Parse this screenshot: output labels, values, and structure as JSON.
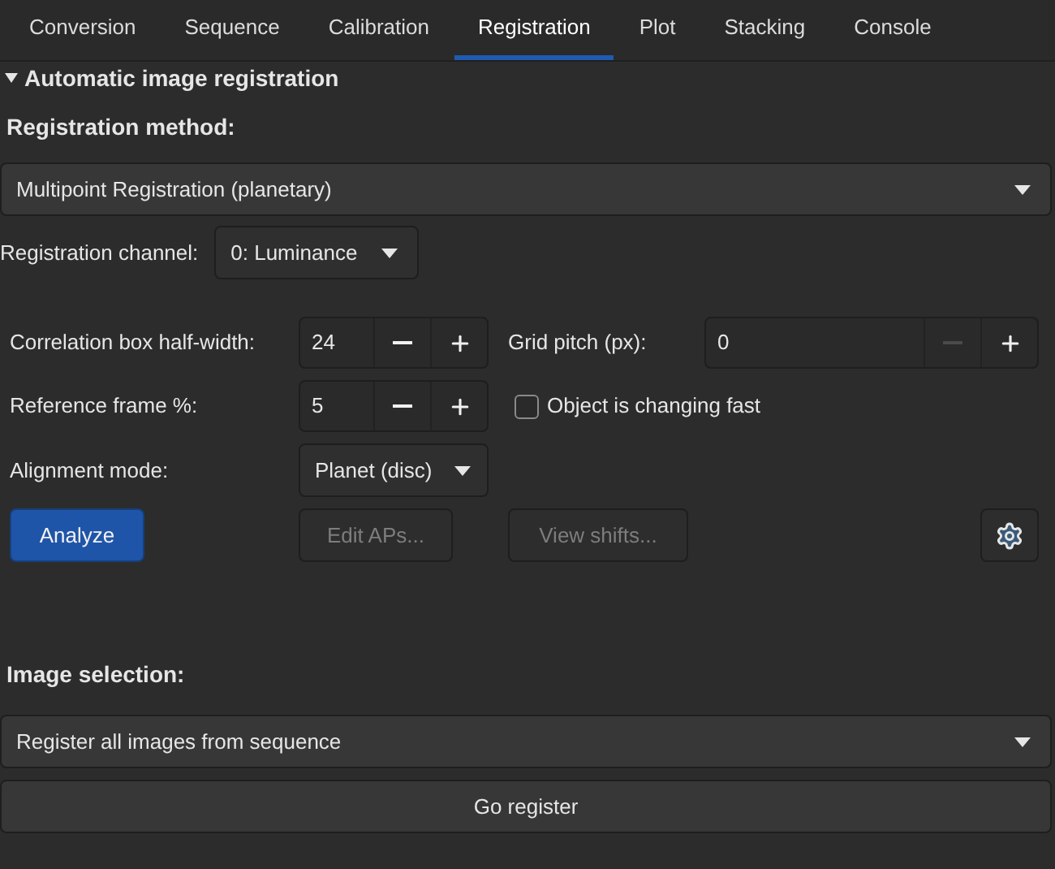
{
  "tabs": [
    {
      "label": "Conversion",
      "selected": false
    },
    {
      "label": "Sequence",
      "selected": false
    },
    {
      "label": "Calibration",
      "selected": false
    },
    {
      "label": "Registration",
      "selected": true
    },
    {
      "label": "Plot",
      "selected": false
    },
    {
      "label": "Stacking",
      "selected": false
    },
    {
      "label": "Console",
      "selected": false
    }
  ],
  "section": {
    "title": "Automatic image registration",
    "expanded": true
  },
  "method": {
    "label": "Registration method:",
    "value": "Multipoint Registration (planetary)"
  },
  "channel": {
    "label": "Registration channel:",
    "value": "0: Luminance"
  },
  "correlation": {
    "label": "Correlation box half-width:",
    "value": "24",
    "minus_disabled": false,
    "plus_disabled": false
  },
  "grid_pitch": {
    "label": "Grid pitch (px):",
    "value": "0",
    "minus_disabled": true,
    "plus_disabled": false
  },
  "reference_frame": {
    "label": "Reference frame %:",
    "value": "5",
    "minus_disabled": false,
    "plus_disabled": false
  },
  "fast_change": {
    "label": "Object is changing fast",
    "checked": false
  },
  "alignment": {
    "label": "Alignment mode:",
    "value": "Planet (disc)"
  },
  "buttons": [
    {
      "label": "Analyze",
      "kind": "primary",
      "disabled": false
    },
    {
      "label": "Edit APs...",
      "kind": "normal",
      "disabled": true
    },
    {
      "label": "View shifts...",
      "kind": "normal",
      "disabled": true
    }
  ],
  "image_selection": {
    "label": "Image selection:",
    "value": "Register all images from sequence"
  },
  "go_button": {
    "label": "Go register"
  }
}
